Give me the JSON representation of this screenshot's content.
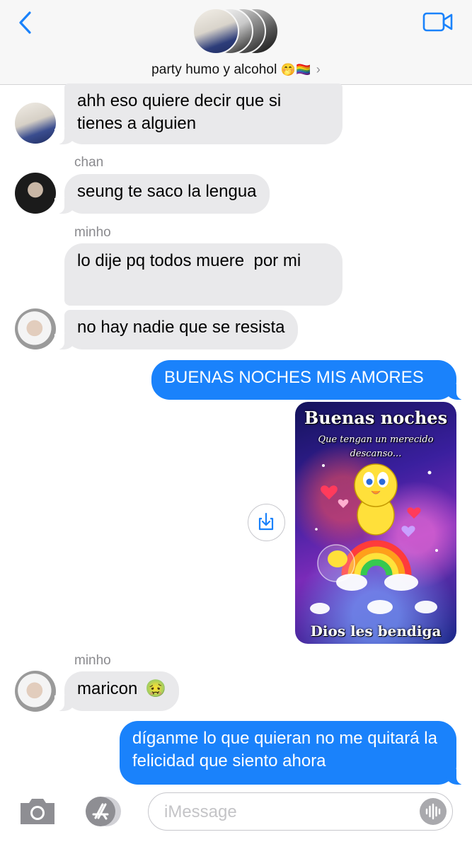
{
  "header": {
    "group_name": "party humo y alcohol",
    "group_emoji": "🤭🏳️‍🌈",
    "chevron": "›"
  },
  "messages": [
    {
      "text": "ahh eso quiere decir que si tienes a alguien"
    },
    {
      "sender": "chan",
      "text": "seung te saco la lengua"
    },
    {
      "sender": "minho",
      "text": "lo dije pq todos muere  por mi"
    },
    {
      "text": "no hay nadie que se resista"
    },
    {
      "text": "BUENAS NOCHES MIS AMORES"
    },
    {
      "sender": "minho",
      "text": "maricon",
      "emoji": "🤢"
    },
    {
      "text": "díganme lo que quieran no me quitará la felicidad que siento ahora"
    }
  ],
  "image_message": {
    "title": "Buenas noches",
    "subtitle": "Que tengan un merecido descanso...",
    "footer": "Dios les bendiga"
  },
  "composer": {
    "placeholder": "iMessage"
  },
  "icons": {
    "back": "chevron-left-icon",
    "video": "video-camera-icon",
    "camera": "camera-icon",
    "apps": "app-store-icon",
    "audio": "audio-waveform-icon",
    "download": "download-icon"
  },
  "colors": {
    "accent": "#1a82fb",
    "incoming_bubble": "#e9e9eb",
    "outgoing_bubble": "#1a82fb"
  }
}
